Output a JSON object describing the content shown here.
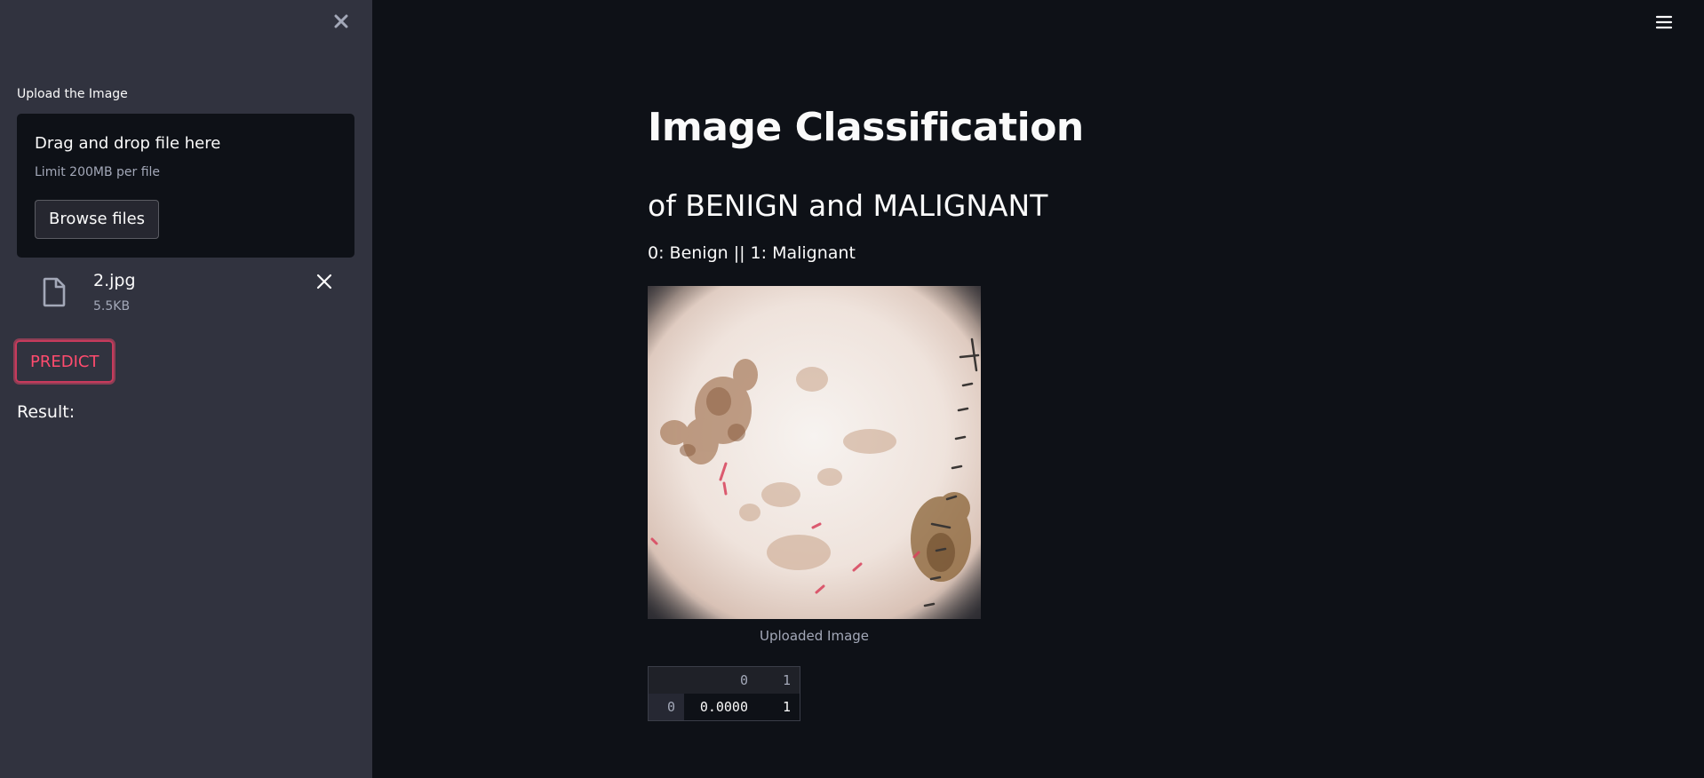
{
  "sidebar": {
    "upload_label": "Upload the Image",
    "dropzone": {
      "title": "Drag and drop file here",
      "limit": "Limit 200MB per file",
      "browse_label": "Browse files"
    },
    "file": {
      "name": "2.jpg",
      "size": "5.5KB"
    },
    "predict_label": "PREDICT",
    "result_label": "Result:"
  },
  "main": {
    "title": "Image Classification",
    "subtitle": "of BENIGN and MALIGNANT",
    "legend": "0: Benign || 1: Malignant",
    "image_caption": "Uploaded Image",
    "dataframe": {
      "columns": [
        "",
        "0",
        "1"
      ],
      "rows": [
        {
          "index": "0",
          "values": [
            "0.0000",
            "1"
          ]
        }
      ]
    }
  },
  "icons": {
    "sidebar_close": "close-icon",
    "file": "file-icon",
    "file_remove": "close-icon",
    "menu": "hamburger-menu-icon"
  },
  "colors": {
    "sidebar_bg": "#31333f",
    "main_bg": "#0e1117",
    "accent": "#ff4b6e",
    "muted_text": "#a3a8b8"
  }
}
